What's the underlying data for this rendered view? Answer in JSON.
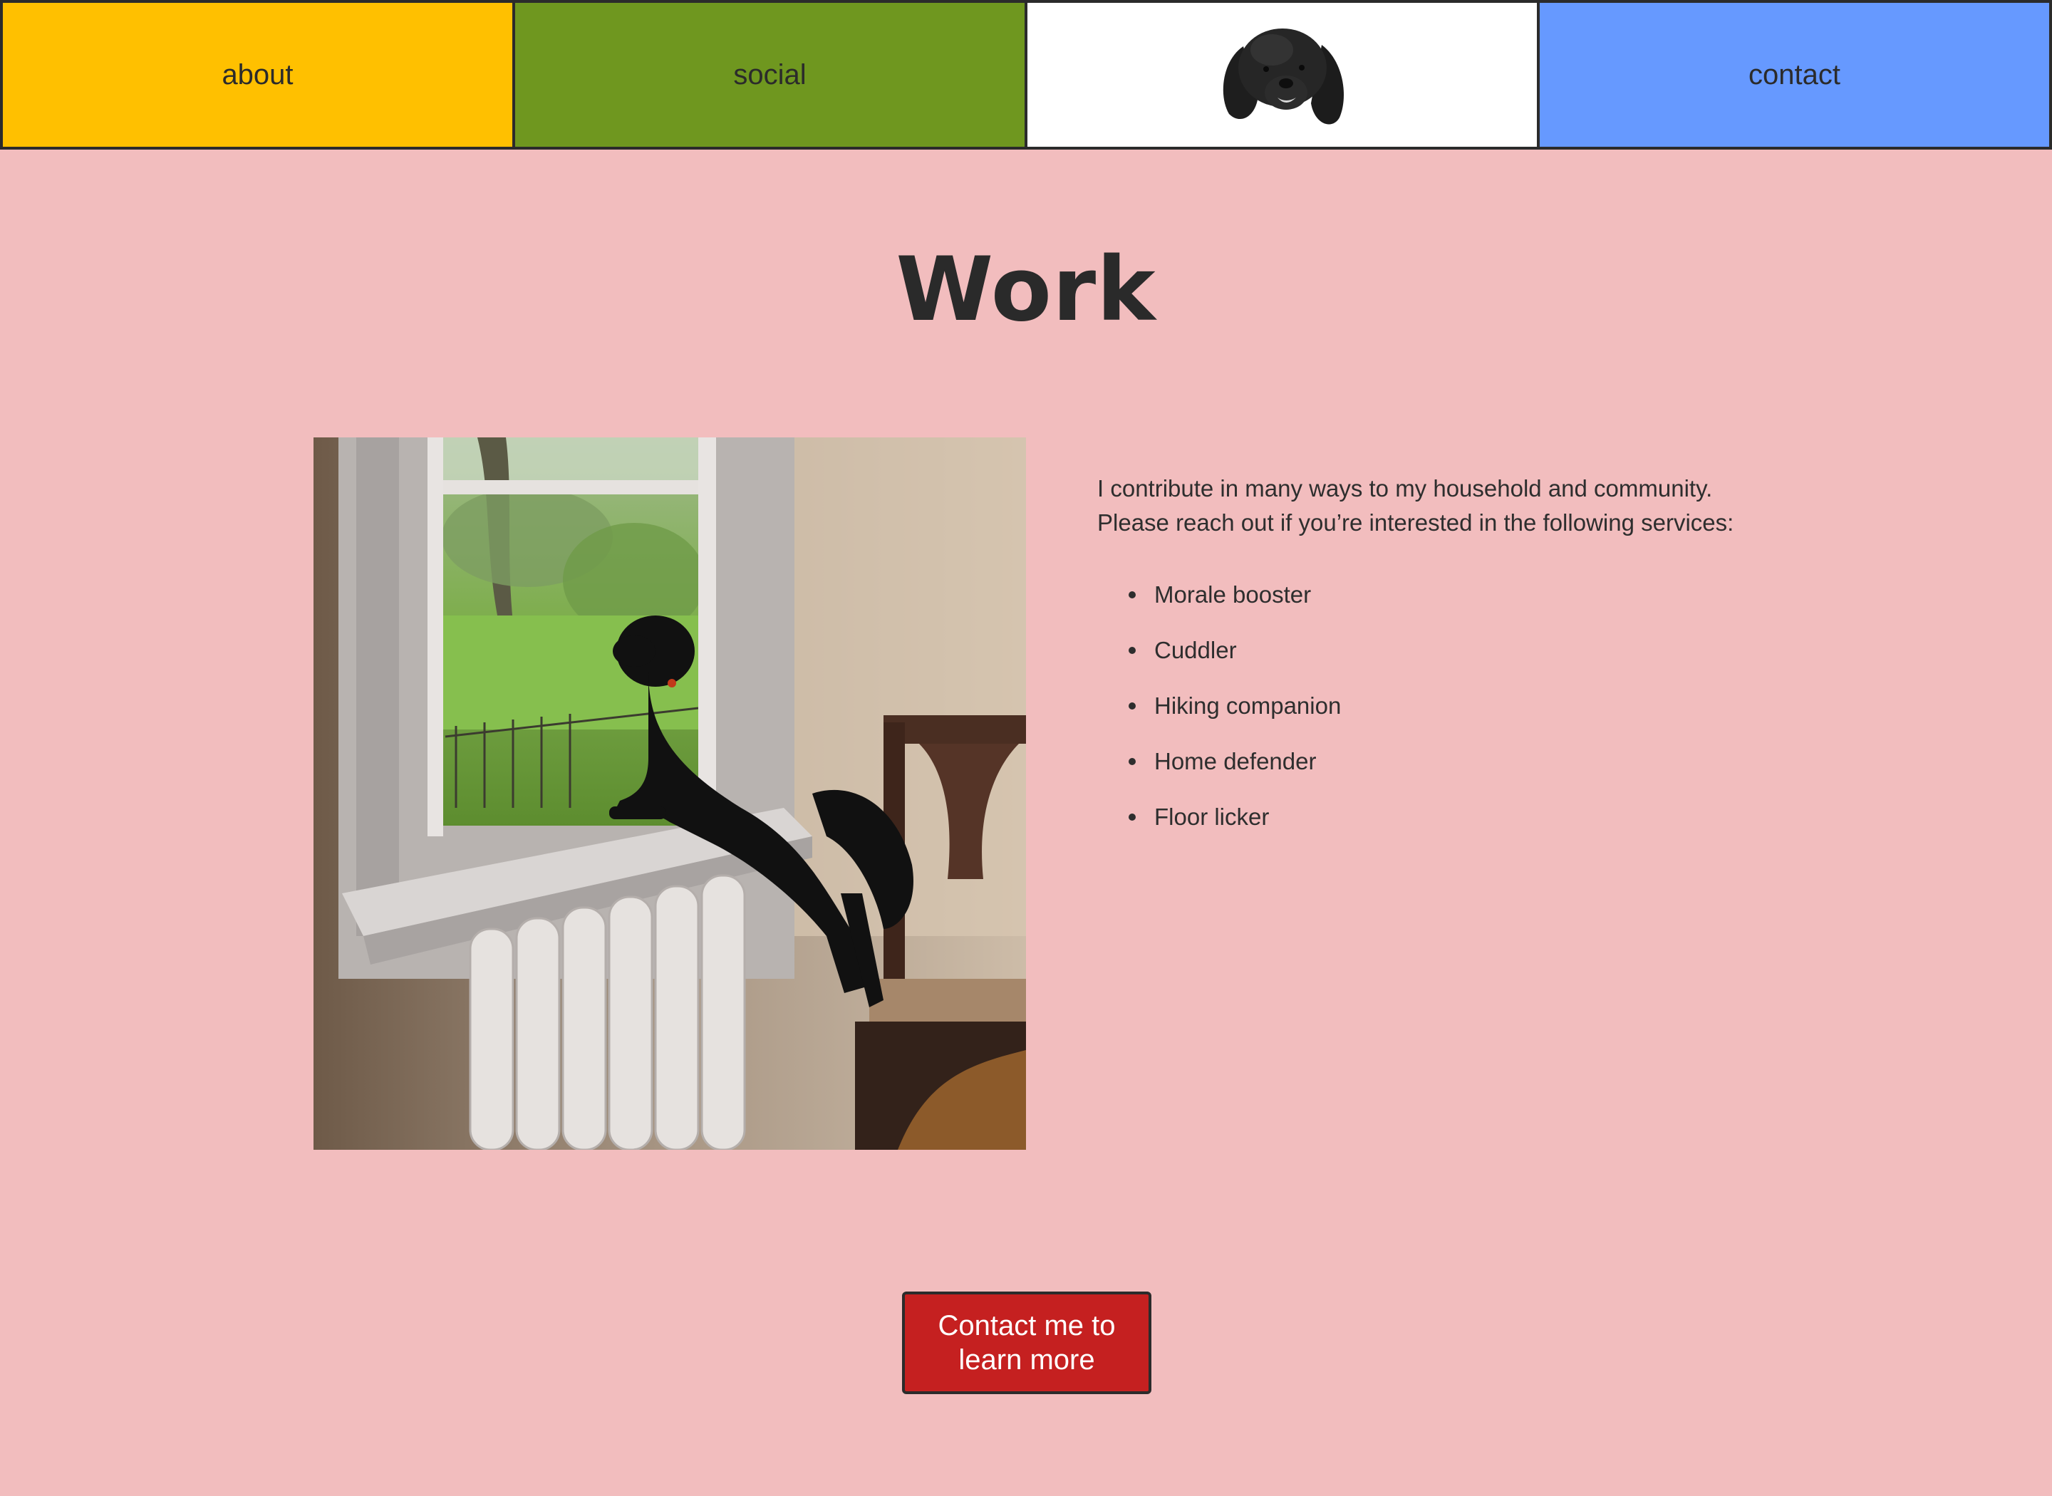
{
  "nav": {
    "about": "about",
    "social": "social",
    "contact": "contact",
    "home_icon": "dog-head-logo"
  },
  "main": {
    "title": "Work",
    "intro": "I contribute in many ways to my household and community. Please reach out if you’re interested in the following services:",
    "services": [
      "Morale booster",
      "Cuddler",
      "Hiking companion",
      "Home defender",
      "Floor licker"
    ],
    "cta_label": "Contact me to learn more"
  },
  "colors": {
    "background": "#f2bdbe",
    "about": "#ffc000",
    "social": "#6f971f",
    "home": "#ffffff",
    "contact": "#6699ff",
    "cta": "#c52020"
  }
}
